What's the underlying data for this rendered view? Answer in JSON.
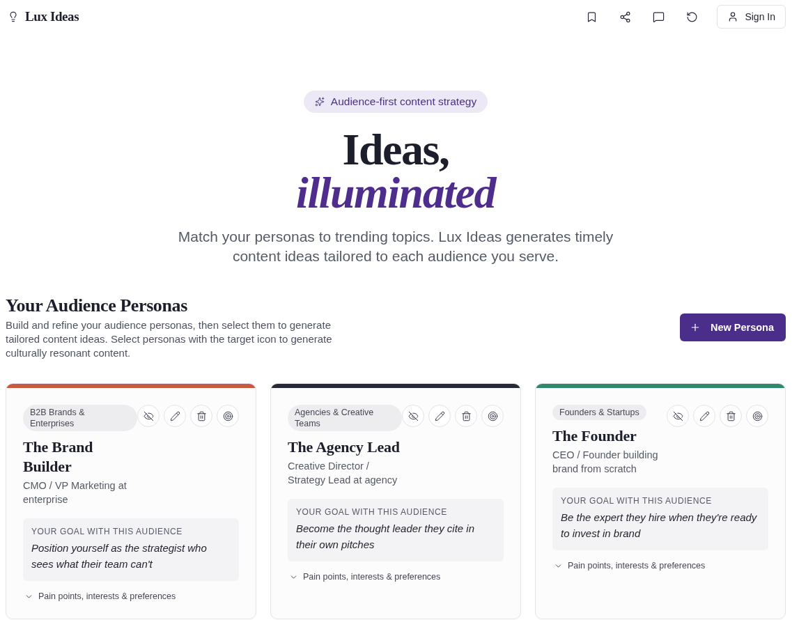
{
  "header": {
    "logo": "Lux Ideas",
    "sign_in": "Sign In"
  },
  "hero": {
    "badge": "Audience-first content strategy",
    "title": "Ideas,",
    "title_accent": "illuminated",
    "subtitle": "Match your personas to trending topics. Lux Ideas generates timely content ideas tailored to each audience you serve."
  },
  "personas_section": {
    "title": "Your Audience Personas",
    "description": "Build and refine your audience personas, then select them to generate tailored content ideas. Select personas with the target icon to generate culturally resonant content.",
    "new_button": "New Persona"
  },
  "personas": [
    {
      "color": "#c8583f",
      "tag": "B2B Brands & Enterprises",
      "name": "The Brand Builder",
      "role": "CMO / VP Marketing at enterprise",
      "goal_label": "YOUR GOAL WITH THIS AUDIENCE",
      "goal": "Position yourself as the strategist who sees what their team can't",
      "details_toggle": "Pain points, interests & preferences",
      "expanded": false
    },
    {
      "color": "#272b39",
      "tag": "Agencies & Creative Teams",
      "name": "The Agency Lead",
      "role": "Creative Director / Strategy Lead at agency",
      "goal_label": "YOUR GOAL WITH THIS AUDIENCE",
      "goal": "Become the thought leader they cite in their own pitches",
      "details_toggle": "Pain points, interests & preferences",
      "expanded": false
    },
    {
      "color": "#2f8a6d",
      "tag": "Founders & Startups",
      "name": "The Founder",
      "role": "CEO / Founder building brand from scratch",
      "goal_label": "YOUR GOAL WITH THIS AUDIENCE",
      "goal": "Be the expert they hire when they're ready to invest in brand",
      "details_toggle": "Pain points, interests & preferences",
      "expanded": false
    }
  ]
}
